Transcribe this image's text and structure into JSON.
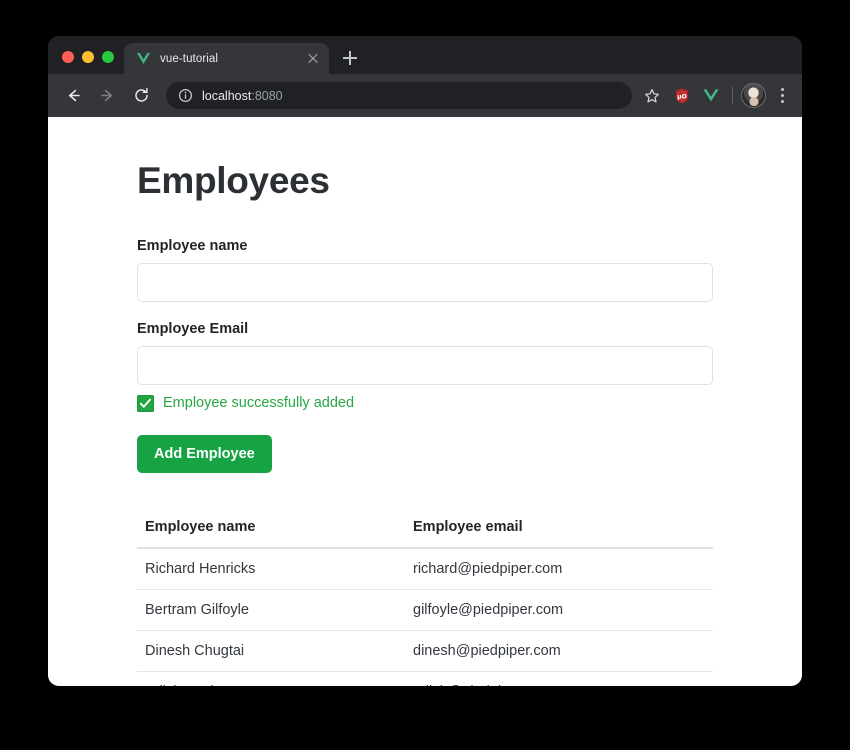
{
  "browser": {
    "window_controls": [
      "close",
      "minimize",
      "maximize"
    ],
    "tab": {
      "title": "vue-tutorial",
      "favicon": "vue-logo-icon",
      "close_label": "Close tab"
    },
    "new_tab_label": "New Tab",
    "nav": {
      "back": "Back",
      "forward": "Forward",
      "reload": "Reload"
    },
    "omnibox": {
      "host": "localhost",
      "port": ":8080",
      "security_icon": "info-circle-icon"
    },
    "actions": {
      "bookmark": "Bookmark this page",
      "ublock": "uBlock Origin",
      "vue_devtools": "Vue.js devtools",
      "profile": "Profile",
      "menu": "Customize and control Google Chrome"
    },
    "colors": {
      "tab_strip_bg": "#202124",
      "toolbar_bg": "#35363a",
      "active_tab_bg": "#35363a",
      "omnibox_bg": "#202124",
      "traffic_red": "#ff5f57",
      "traffic_yellow": "#febc2e",
      "traffic_green": "#28c840",
      "vue_green": "#42b883",
      "ublock_red": "#a32626"
    }
  },
  "page": {
    "title": "Employees",
    "form": {
      "name_label": "Employee name",
      "name_value": "",
      "name_placeholder": "",
      "email_label": "Employee Email",
      "email_value": "",
      "email_placeholder": "",
      "success_message": "Employee successfully added",
      "success_checked": true,
      "submit_label": "Add Employee"
    },
    "table": {
      "columns": [
        "Employee name",
        "Employee email"
      ],
      "rows": [
        {
          "name": "Richard Henricks",
          "email": "richard@piedpiper.com"
        },
        {
          "name": "Bertram Gilfoyle",
          "email": "gilfoyle@piedpiper.com"
        },
        {
          "name": "Dinesh Chugtai",
          "email": "dinesh@piedpiper.com"
        },
        {
          "name": "Erlich Bachmann",
          "email": "erlich@piedpiper.com"
        }
      ]
    },
    "colors": {
      "success_green": "#28a745",
      "button_green": "#17a344",
      "heading": "#2c3034",
      "page_bg": "#ffffff"
    }
  }
}
